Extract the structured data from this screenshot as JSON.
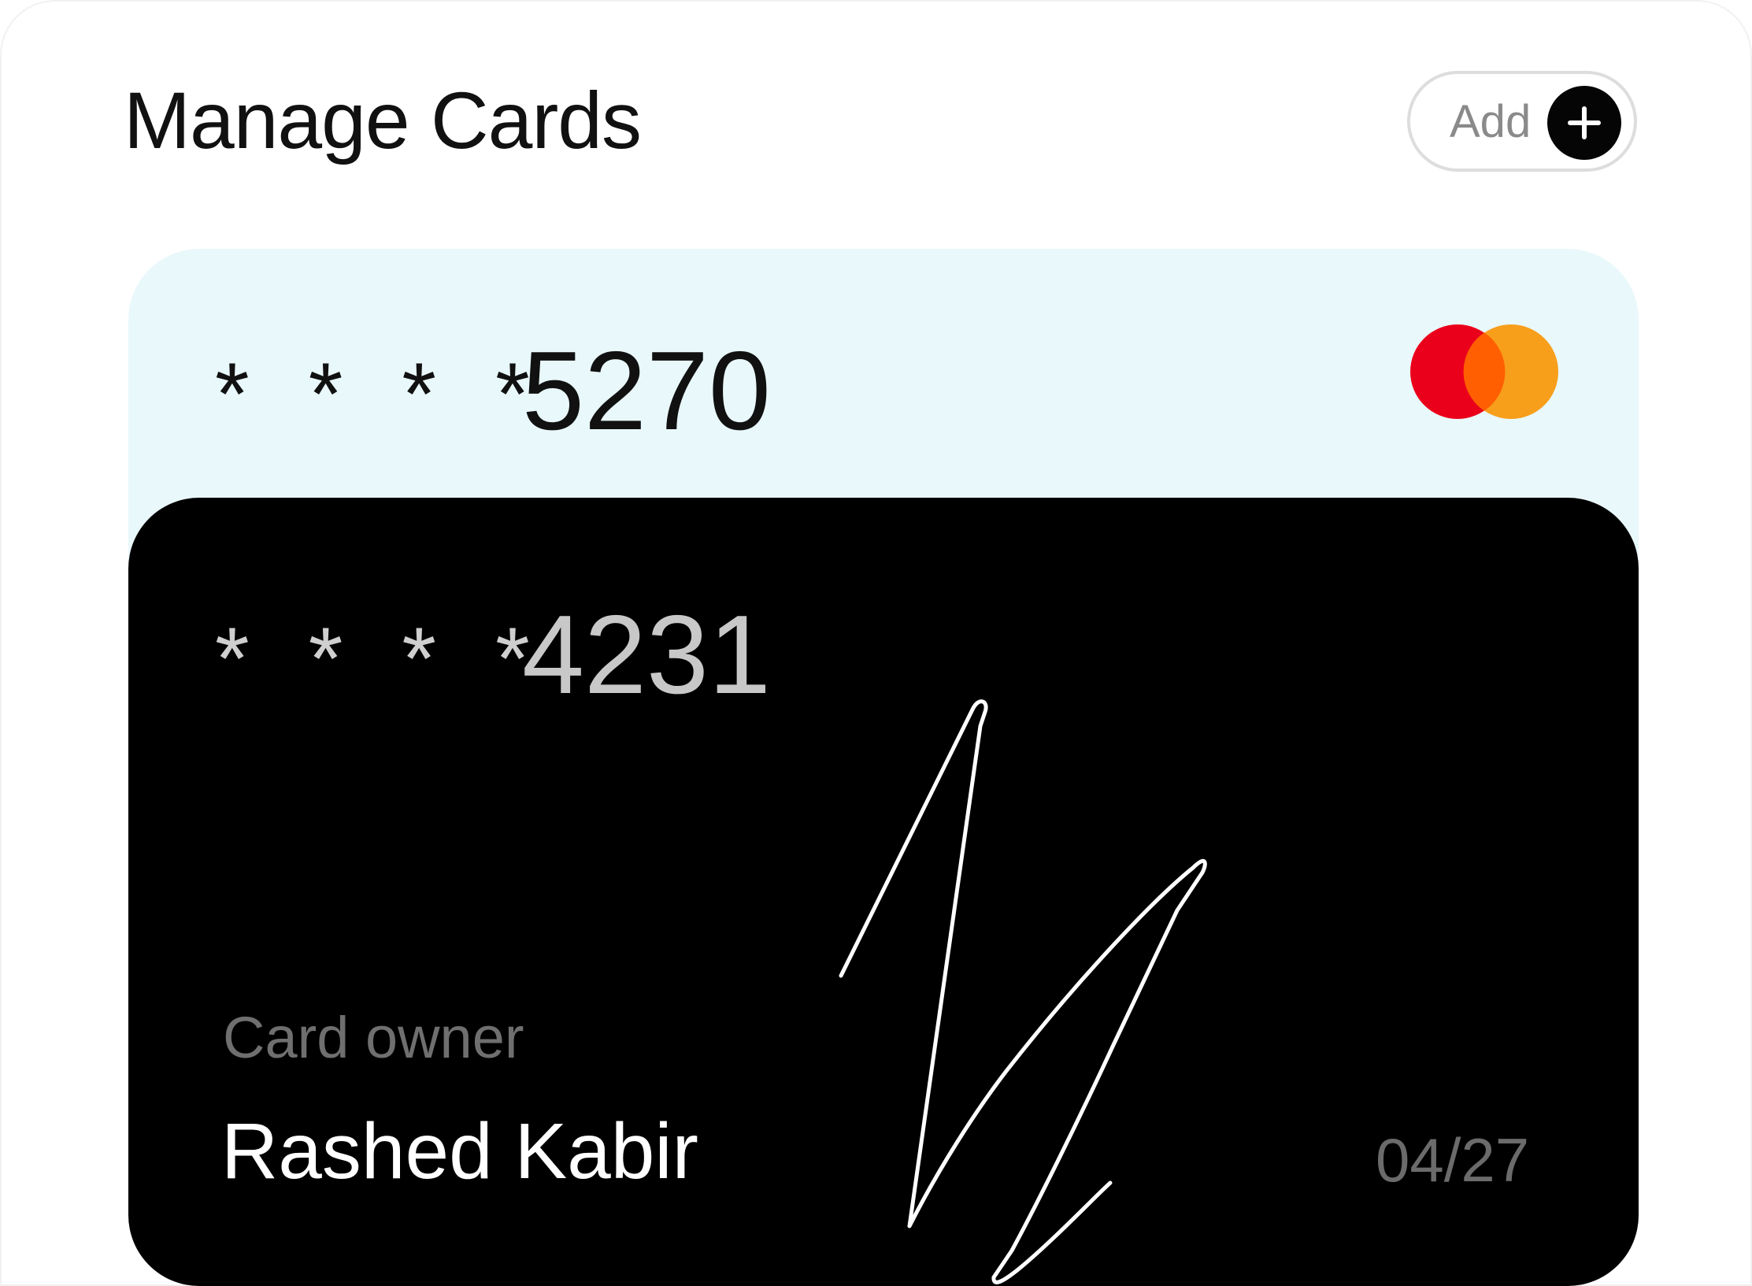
{
  "header": {
    "title": "Manage Cards",
    "add_button_label": "Add",
    "add_icon": "plus-icon"
  },
  "cards": [
    {
      "masked_prefix": "* * * *",
      "last4": "5270",
      "brand_icon": "mastercard-logo",
      "background_color": "#e9f8fa"
    },
    {
      "masked_prefix": "* * * *",
      "last4": "4231",
      "owner_label": "Card owner",
      "owner_name": "Rashed Kabir",
      "expiry": "04/27",
      "background_color": "#000000",
      "signature_icon": "signature"
    }
  ],
  "colors": {
    "mastercard_red": "#eb001b",
    "mastercard_orange": "#f79e1b",
    "mastercard_overlap": "#ff5f00"
  }
}
